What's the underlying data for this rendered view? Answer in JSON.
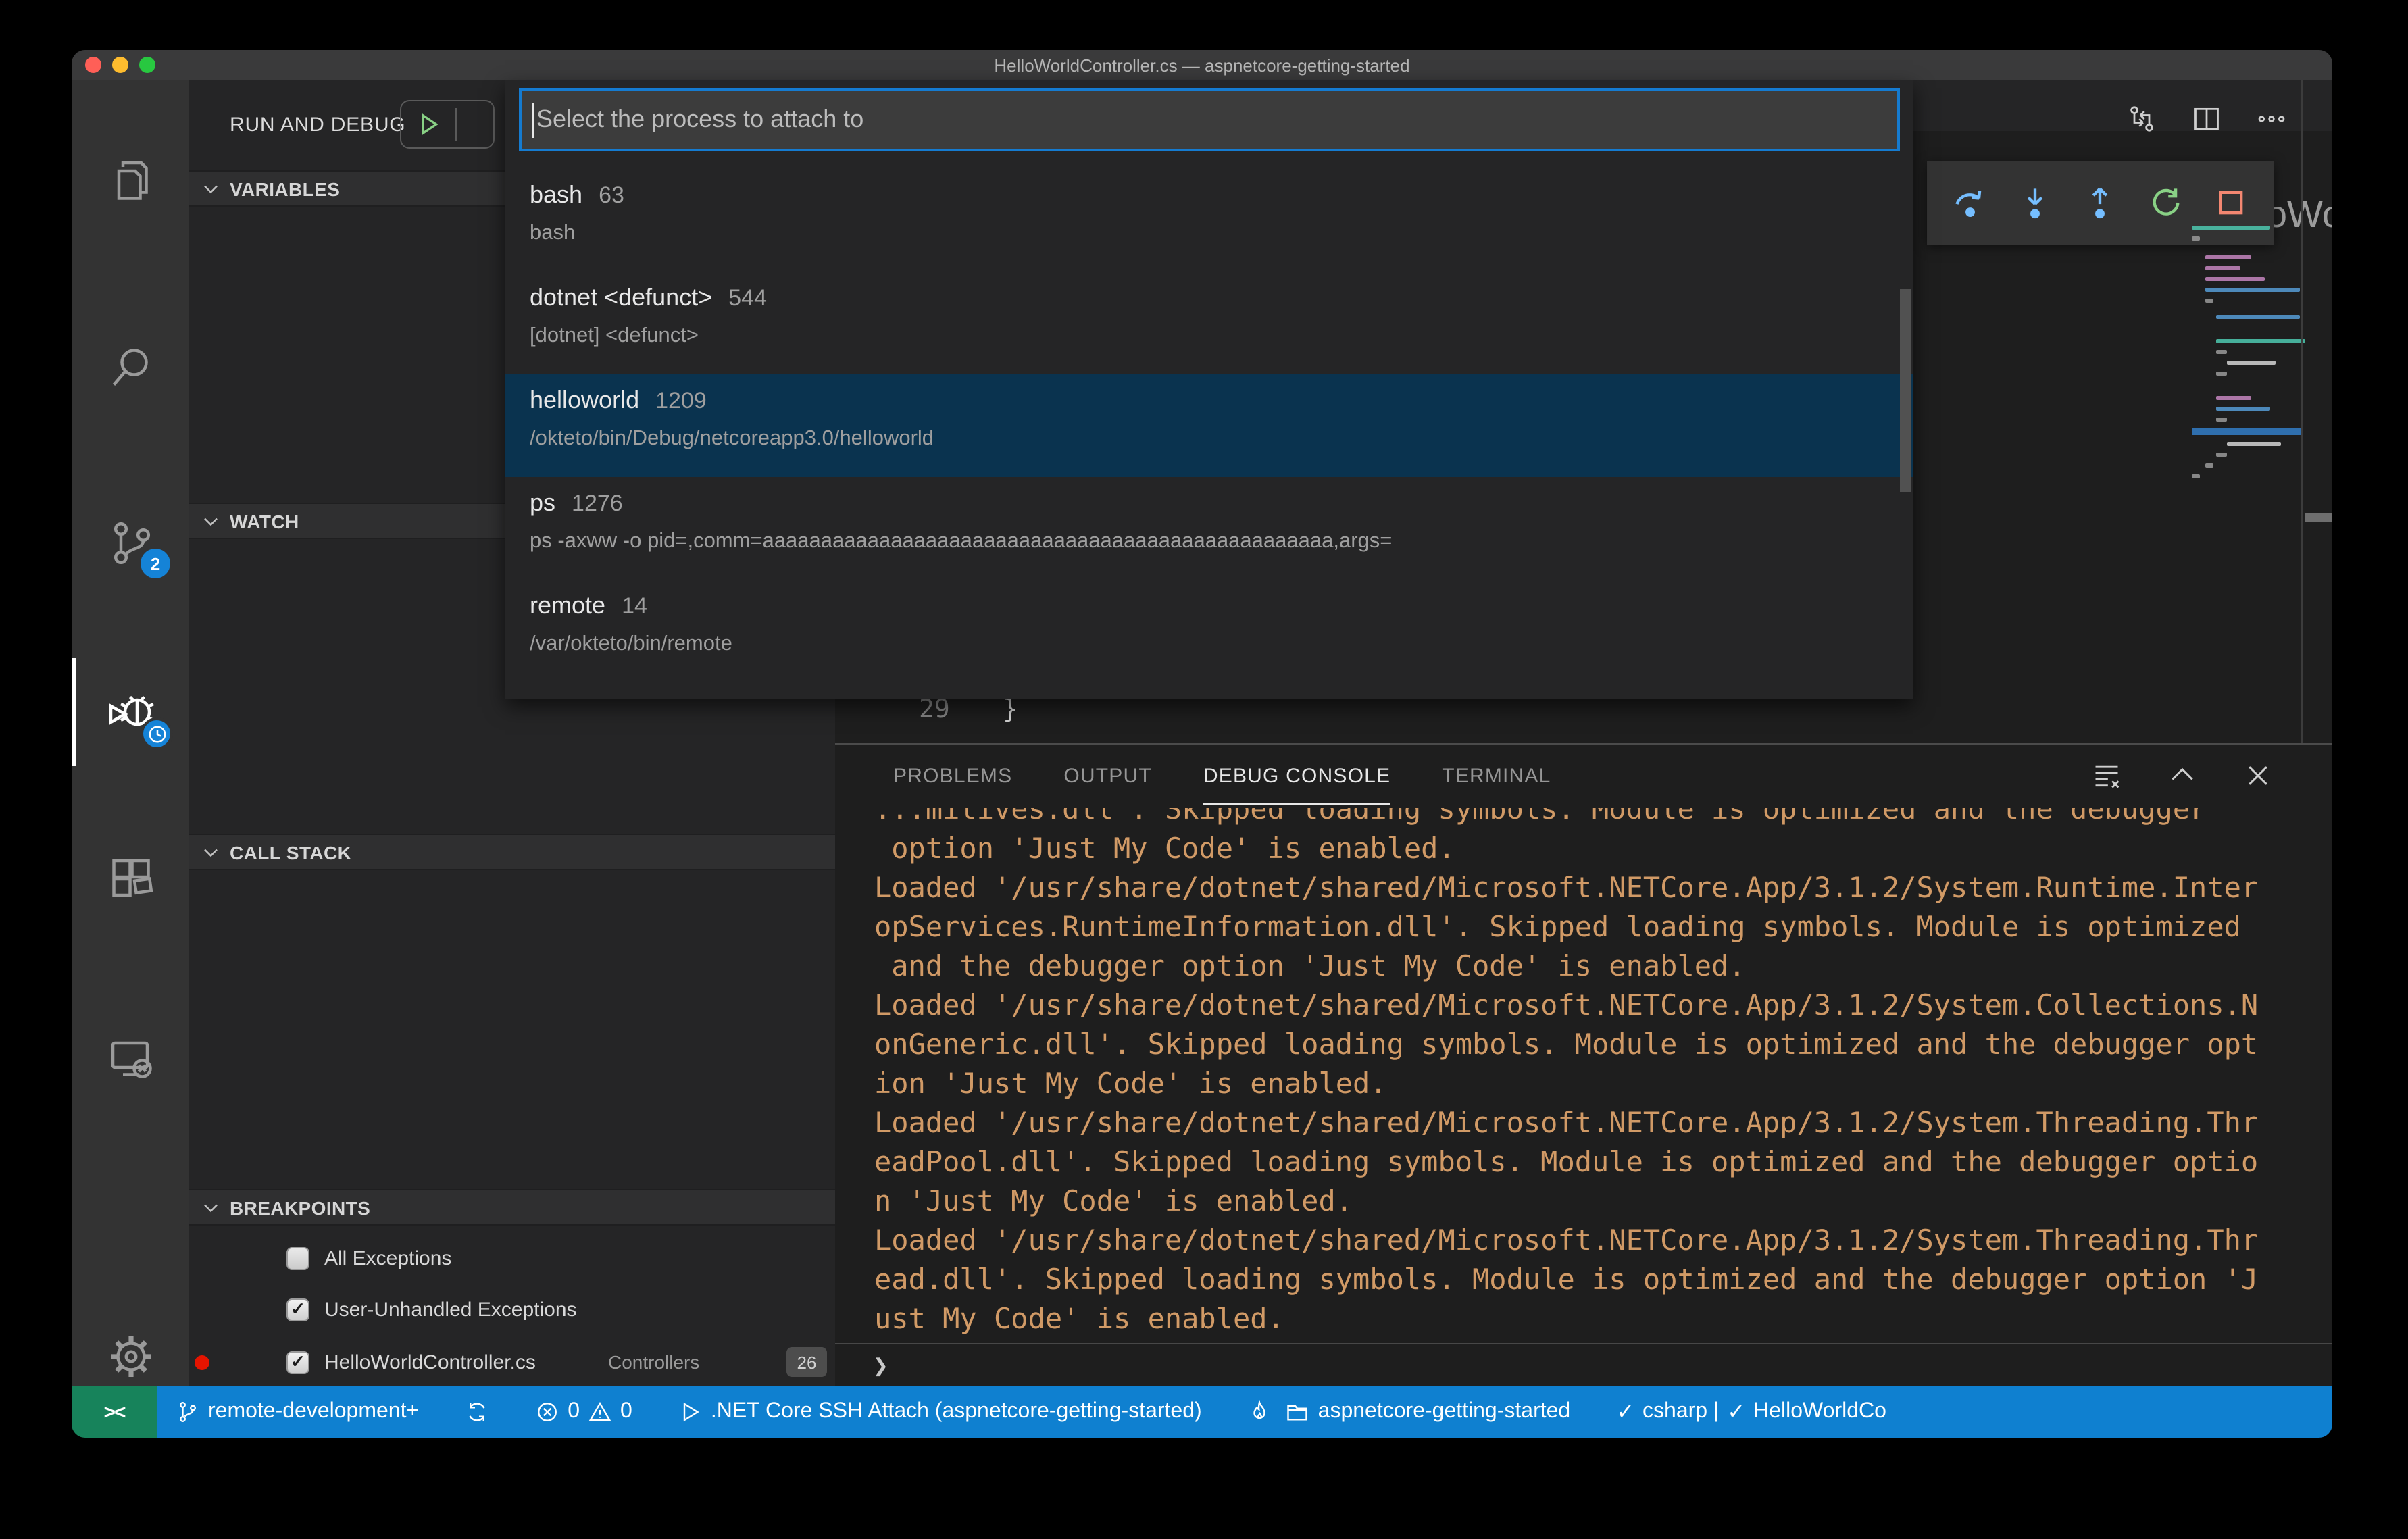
{
  "window": {
    "title": "HelloWorldController.cs — aspnetcore-getting-started"
  },
  "colors": {
    "status_bar_blue": "#0f80d0",
    "remote_green": "#17835b",
    "selection_blue": "#0a334f",
    "console_orange": "#d19a66",
    "badge_blue": "#1583d7",
    "step_blue": "#75beff",
    "restart_green": "#89d185",
    "stop_red": "#f48771"
  },
  "activity_bar": {
    "badge_scm": "2",
    "icons": [
      "explorer-icon",
      "search-icon",
      "source-control-icon",
      "run-and-debug-icon",
      "extensions-icon",
      "remote-explorer-icon",
      "settings-gear-icon"
    ]
  },
  "sidebar": {
    "header_title": "RUN AND DEBUG",
    "sections": {
      "variables": "VARIABLES",
      "watch": "WATCH",
      "call_stack": "CALL STACK",
      "breakpoints": "BREAKPOINTS"
    },
    "breakpoints": [
      {
        "label": "All Exceptions",
        "checked": false,
        "check_glyph": ""
      },
      {
        "label": "User-Unhandled Exceptions",
        "checked": true,
        "check_glyph": "✓"
      },
      {
        "label": "HelloWorldController.cs",
        "checked": true,
        "check_glyph": "✓",
        "location": "Controllers",
        "line_badge": "26"
      }
    ]
  },
  "quickpick": {
    "placeholder": "Select the process to attach to",
    "items": [
      {
        "name": "bash",
        "pid": "63",
        "description": "bash"
      },
      {
        "name": "dotnet <defunct>",
        "pid": "544",
        "description": "[dotnet] <defunct>"
      },
      {
        "name": "helloworld",
        "pid": "1209",
        "description": "/okteto/bin/Debug/netcoreapp3.0/helloworld",
        "selected": true
      },
      {
        "name": "ps",
        "pid": "1276",
        "description": "ps -axww -o pid=,comm=aaaaaaaaaaaaaaaaaaaaaaaaaaaaaaaaaaaaaaaaaaaaaaaaa,args="
      },
      {
        "name": "remote",
        "pid": "14",
        "description": "/var/okteto/bin/remote"
      }
    ]
  },
  "editor": {
    "visible_line_number": "29",
    "visible_line_text": "}",
    "tab_fragment": "loWo"
  },
  "panel": {
    "tabs": [
      {
        "label": "PROBLEMS"
      },
      {
        "label": "OUTPUT"
      },
      {
        "label": "DEBUG CONSOLE",
        "active": true
      },
      {
        "label": "TERMINAL"
      }
    ],
    "console_lines": [
      "...mitives.dll'. Skipped loading symbols. Module is optimized and the debugger",
      " option 'Just My Code' is enabled.",
      "Loaded '/usr/share/dotnet/shared/Microsoft.NETCore.App/3.1.2/System.Runtime.Inter",
      "opServices.RuntimeInformation.dll'. Skipped loading symbols. Module is optimized",
      " and the debugger option 'Just My Code' is enabled.",
      "Loaded '/usr/share/dotnet/shared/Microsoft.NETCore.App/3.1.2/System.Collections.N",
      "onGeneric.dll'. Skipped loading symbols. Module is optimized and the debugger opt",
      "ion 'Just My Code' is enabled.",
      "Loaded '/usr/share/dotnet/shared/Microsoft.NETCore.App/3.1.2/System.Threading.Thr",
      "eadPool.dll'. Skipped loading symbols. Module is optimized and the debugger optio",
      "n 'Just My Code' is enabled.",
      "Loaded '/usr/share/dotnet/shared/Microsoft.NETCore.App/3.1.2/System.Threading.Thr",
      "ead.dll'. Skipped loading symbols. Module is optimized and the debugger option 'J",
      "ust My Code' is enabled."
    ],
    "prompt": "❯"
  },
  "status_bar": {
    "remote_glyph": "><",
    "branch": "remote-development+",
    "errors": "0",
    "warnings": "0",
    "debug_session": ".NET Core SSH Attach (aspnetcore-getting-started)",
    "folder": "aspnetcore-getting-started",
    "lang_check": "✓",
    "language": "csharp |",
    "project_check": "✓",
    "project": "HelloWorldCo"
  }
}
